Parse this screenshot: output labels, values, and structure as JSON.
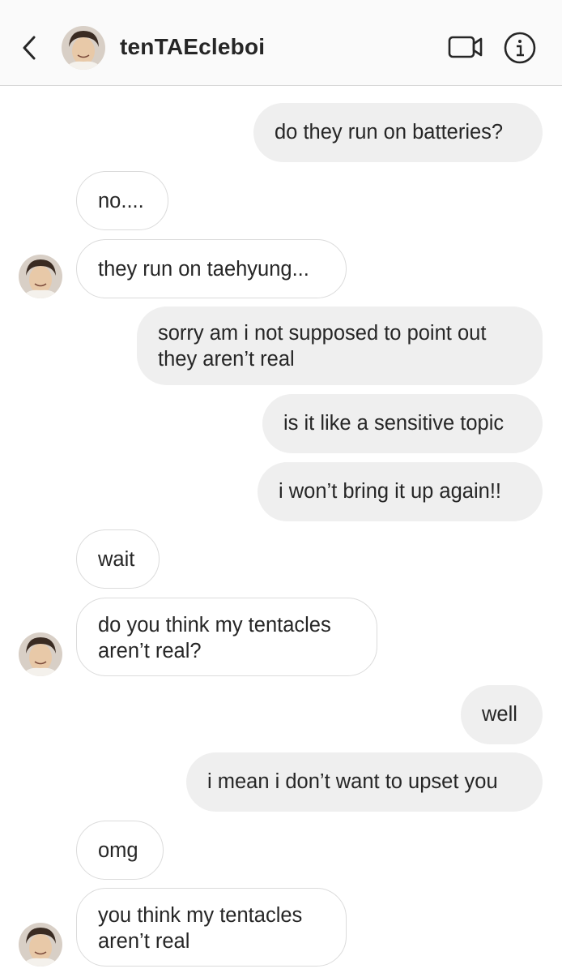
{
  "header": {
    "back_icon": "chevron-left-icon",
    "username": "tenTAEcleboi",
    "video_icon": "video-camera-icon",
    "info_icon": "info-circle-icon"
  },
  "messages": [
    {
      "side": "sent",
      "lines": [
        "do they run on batteries?"
      ]
    },
    {
      "side": "received",
      "lines": [
        "no...."
      ]
    },
    {
      "side": "received",
      "lines": [
        "they run on taehyung..."
      ]
    },
    {
      "side": "sent",
      "lines": [
        "sorry am i not supposed to point out",
        "they aren’t real"
      ]
    },
    {
      "side": "sent",
      "lines": [
        "is it like a sensitive topic"
      ]
    },
    {
      "side": "sent",
      "lines": [
        "i won’t bring it up again!!"
      ]
    },
    {
      "side": "received",
      "lines": [
        "wait"
      ]
    },
    {
      "side": "received",
      "lines": [
        "do you think my tentacles",
        "aren’t real?"
      ]
    },
    {
      "side": "sent",
      "lines": [
        "well"
      ]
    },
    {
      "side": "sent",
      "lines": [
        "i mean i don’t want to upset you"
      ]
    },
    {
      "side": "received",
      "lines": [
        "omg"
      ]
    },
    {
      "side": "received",
      "lines": [
        "you think my tentacles",
        "aren’t real"
      ]
    }
  ],
  "colors": {
    "sent_bubble": "#efefef",
    "received_border": "#dbdbdb",
    "text": "#262626",
    "header_bg": "#fafafa"
  }
}
